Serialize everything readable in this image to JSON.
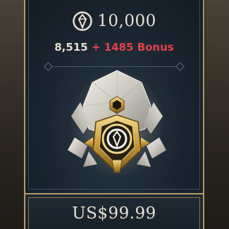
{
  "offer": {
    "currency_icon": "riot-points-icon",
    "total_amount": "10,000",
    "base_amount": "8,515",
    "bonus_amount": "+ 1485 Bonus",
    "price": "US$99.99"
  },
  "colors": {
    "accent_gold": "#b59a63",
    "bonus_red": "#e0434d",
    "text_light": "#e7e1d4",
    "card_bg": "#1a2530"
  }
}
